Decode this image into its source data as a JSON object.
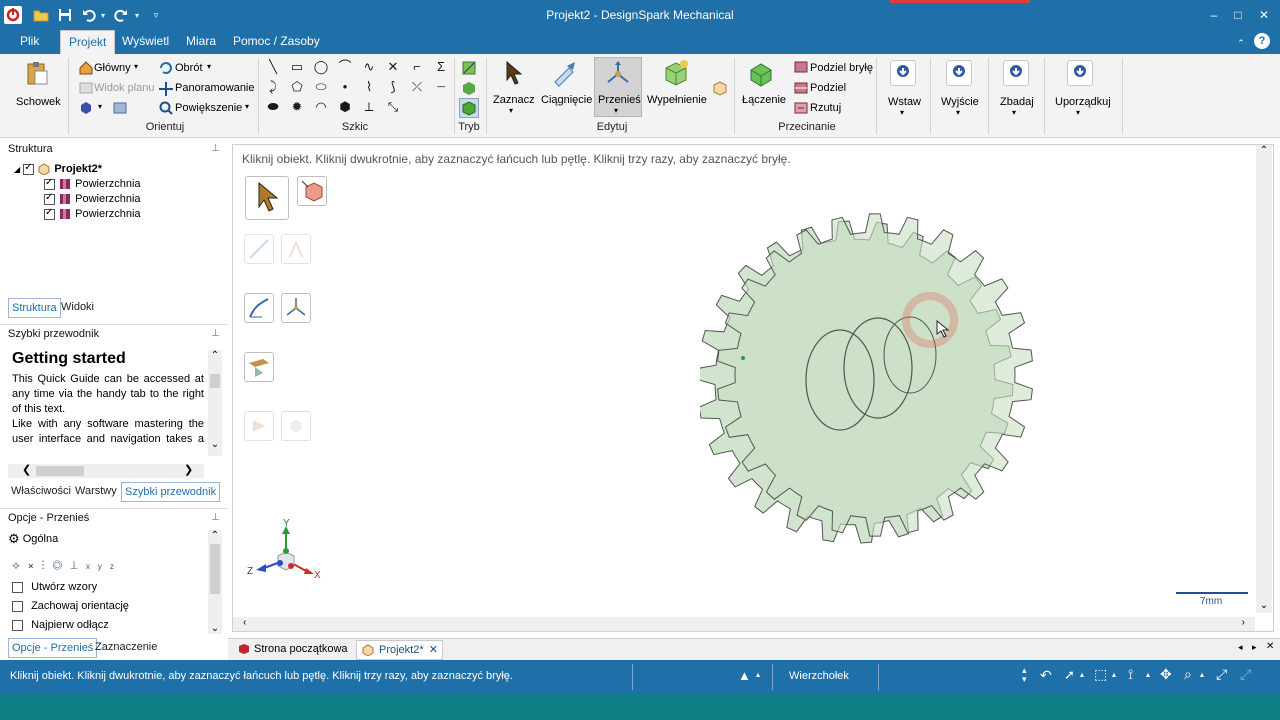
{
  "window": {
    "title": "Projekt2 - DesignSpark Mechanical",
    "min": "–",
    "max": "□",
    "close": "✕"
  },
  "menu_tabs": [
    "Plik",
    "Projekt",
    "Wyświetl",
    "Miara",
    "Pomoc / Zasoby"
  ],
  "ribbon": {
    "schowek": "Schowek",
    "orientuj": {
      "glowny": "Główny",
      "widok_planu": "Widok planu",
      "obrot": "Obrót",
      "panoramowanie": "Panoramowanie",
      "powiekszenie": "Powiększenie",
      "group": "Orientuj"
    },
    "szkic_group": "Szkic",
    "tryb_group": "Tryb",
    "edytuj": {
      "zaznacz": "Zaznacz",
      "ciagniecie": "Ciągnięcie",
      "przenies": "Przenieś",
      "wypelnienie": "Wypełnienie",
      "group": "Edytuj"
    },
    "przecinanie": {
      "laczenie": "Łączenie",
      "podziel_bryle": "Podziel bryłę",
      "podziel": "Podziel",
      "rzutuj": "Rzutuj",
      "group": "Przecinanie"
    },
    "wstaw": "Wstaw",
    "wyjscie": "Wyjście",
    "zbadaj": "Zbadaj",
    "uporzadkuj": "Uporządkuj"
  },
  "structure": {
    "header": "Struktura",
    "root": "Projekt2*",
    "items": [
      "Powierzchnia",
      "Powierzchnia",
      "Powierzchnia"
    ],
    "tabs": [
      "Struktura",
      "Widoki"
    ]
  },
  "quick_guide": {
    "header": "Szybki przewodnik",
    "title": "Getting started",
    "para1": "This Quick Guide can be accessed at any time via the handy tab to the right of this text.",
    "para2": "Like with any software mastering the user interface and navigation takes a bit of practice. Please select a topic of",
    "tabs": [
      "Właściwości",
      "Warstwy",
      "Szybki przewodnik"
    ]
  },
  "options": {
    "header": "Opcje - Przenieś",
    "section": "Ogólna",
    "checkboxes": [
      "Utwórz wzory",
      "Zachowaj orientację",
      "Najpierw odłącz"
    ],
    "tabs": [
      "Opcje - Przenieś",
      "Zaznaczenie"
    ]
  },
  "canvas": {
    "hint": "Kliknij obiekt.  Kliknij dwukrotnie, aby zaznaczyć łańcuch lub pętlę.  Kliknij trzy razy, aby zaznaczyć bryłę.",
    "scale": "7mm",
    "triad": {
      "x": "X",
      "y": "Y",
      "z": "Z"
    },
    "gear_color": "#c9dfc5",
    "gear_stroke": "#555555"
  },
  "doc_tabs": [
    "Strona początkowa",
    "Projekt2*"
  ],
  "status": {
    "text": "Kliknij obiekt.  Kliknij dwukrotnie, aby zaznaczyć łańcuch lub pętlę.  Kliknij trzy razy, aby zaznaczyć bryłę.",
    "mode": "Wierzchołek"
  },
  "colors": {
    "accent": "#1f6fa8",
    "bottom_bar": "#0f7f86"
  }
}
